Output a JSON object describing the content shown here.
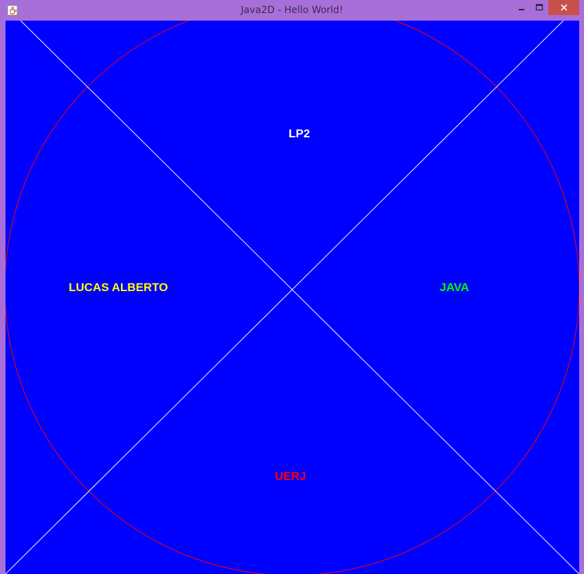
{
  "window": {
    "title": "Java2D - Hello World!",
    "icon": "java-cup-icon",
    "controls": [
      "minimize-icon",
      "maximize-icon",
      "close-icon"
    ],
    "close_color": "#c7504a",
    "frame_color": "#a86fd9"
  },
  "canvas": {
    "background": "#0000ff",
    "circle_color": "#ff0000",
    "line_color": "#ffffff",
    "labels": {
      "top": {
        "text": "LP2",
        "color": "#ffffff"
      },
      "left": {
        "text": "LUCAS ALBERTO",
        "color": "#ffff00"
      },
      "right": {
        "text": "JAVA",
        "color": "#00ff00"
      },
      "bottom": {
        "text": "UERJ",
        "color": "#ff0000"
      }
    }
  }
}
